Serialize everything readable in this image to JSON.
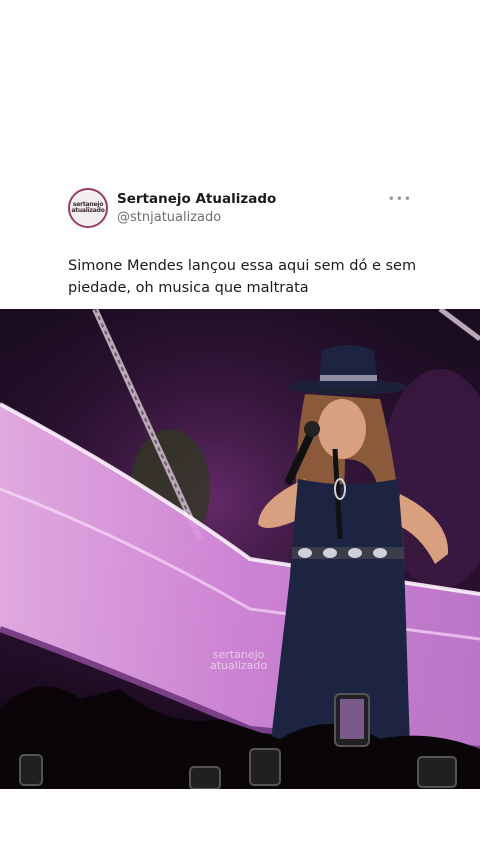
{
  "tweet": {
    "author": {
      "name": "Sertanejo Atualizado",
      "handle": "@stnjatualizado",
      "avatar_text": [
        "sertanejo",
        "atualizado"
      ]
    },
    "more_icon": "more-horizontal-icon",
    "text": "Simone Mendes lançou essa aqui sem dó e sem piedade, oh musica que maltrata",
    "media": {
      "watermark_line1": "sertanejo",
      "watermark_line2": "atualizado"
    }
  },
  "colors": {
    "text": "#1b1b1b",
    "muted": "#6e6e6e",
    "stage_pink": "#e39ae6",
    "background": "#ffffff"
  }
}
